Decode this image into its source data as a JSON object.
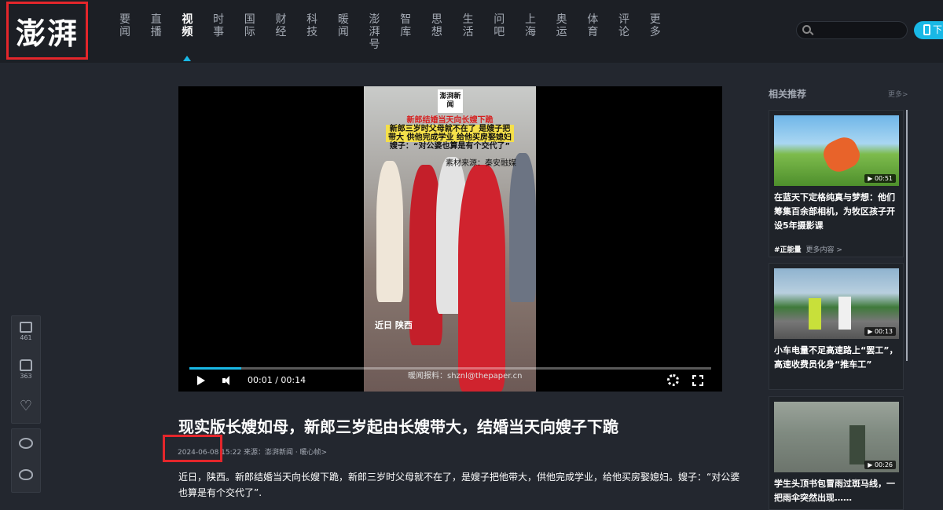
{
  "logo": {
    "text": "澎湃"
  },
  "nav": {
    "items": [
      {
        "label": "要闻",
        "active": false
      },
      {
        "label": "直播",
        "active": false
      },
      {
        "label": "视频",
        "active": true
      },
      {
        "label": "时事",
        "active": false
      },
      {
        "label": "国际",
        "active": false
      },
      {
        "label": "财经",
        "active": false
      },
      {
        "label": "科技",
        "active": false
      },
      {
        "label": "暖闻",
        "active": false
      },
      {
        "label": "澎湃号",
        "active": false
      },
      {
        "label": "智库",
        "active": false
      },
      {
        "label": "思想",
        "active": false
      },
      {
        "label": "生活",
        "active": false
      },
      {
        "label": "问吧",
        "active": false
      },
      {
        "label": "上海",
        "active": false
      },
      {
        "label": "奥运",
        "active": false
      },
      {
        "label": "体育",
        "active": false
      },
      {
        "label": "评论",
        "active": false
      },
      {
        "label": "更多",
        "active": false
      }
    ]
  },
  "header": {
    "search_placeholder": "",
    "download_label": "下"
  },
  "video": {
    "overlay_logo": "澎湃新闻",
    "caption_line1": "新郎结婚当天向长嫂下跪",
    "caption_line2": "新郎三岁时父母就不在了 是嫂子把他",
    "caption_line3": "带大 供他完成学业 给他买房娶媳妇",
    "caption_line4": "嫂子：“对公婆也算是有个交代了”",
    "source": "素材来源：秦安融媒",
    "location": "近日 陕西",
    "email": "暖闻报料：shznl@thepaper.cn",
    "time": "00:01 / 00:14",
    "progress": 0.1
  },
  "article": {
    "title": "现实版长嫂如母，新郎三岁起由长嫂带大，结婚当天向嫂子下跪",
    "meta": "2024-06-08 15:22 来源：澎湃新闻 · 暖心帧>",
    "summary": "近日，陕西。新郎结婚当天向长嫂下跪，新郎三岁时父母就不在了，是嫂子把他带大，供他完成学业，给他买房娶媳妇。嫂子：“对公婆也算是有个交代了”."
  },
  "sharebar": {
    "comments": "461",
    "likes": "363"
  },
  "related": {
    "heading": "相关推荐",
    "more": "更多>",
    "cards": [
      {
        "duration": "00:51",
        "title": "在蓝天下定格纯真与梦想：他们筹集百余部相机，为牧区孩子开设5年摄影课",
        "tag": "#正能量",
        "tag_more": "更多内容 >"
      },
      {
        "duration": "00:13",
        "title": "小车电量不足高速路上“罢工”，高速收费员化身“推车工”",
        "tag": "",
        "tag_more": ""
      },
      {
        "duration": "00:26",
        "title": "学生头顶书包冒雨过斑马线，一把雨伞突然出现……",
        "tag": "",
        "tag_more": ""
      }
    ]
  }
}
